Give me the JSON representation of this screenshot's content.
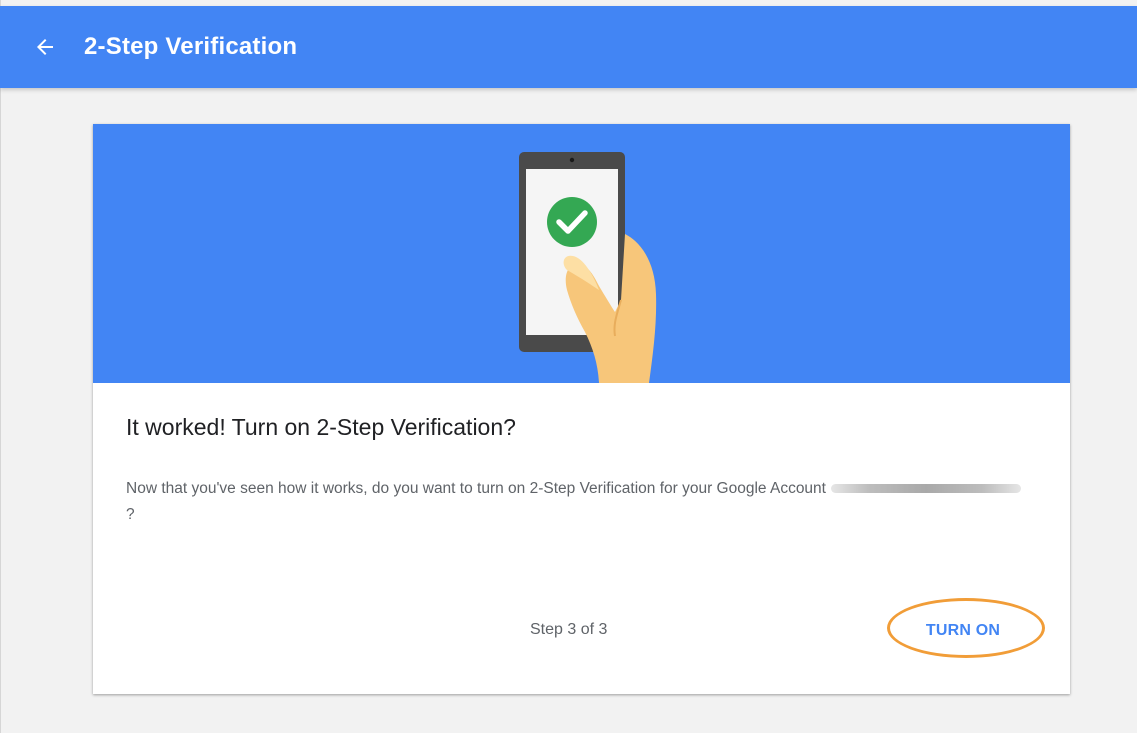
{
  "header": {
    "title": "2-Step Verification",
    "back_icon": "arrow-left-icon",
    "background_color": "#4285f4"
  },
  "hero": {
    "illustration": "phone-checkmark-hand",
    "background_color": "#4285f4",
    "check_color": "#34a853"
  },
  "card": {
    "title": "It worked! Turn on 2-Step Verification?",
    "body_prefix": "Now that you've seen how it works, do you want to turn on 2-Step Verification for your Google Account ",
    "body_suffix": "?",
    "step_text": "Step 3 of 3",
    "turn_on_label": "TURN ON",
    "accent_color": "#4285f4"
  },
  "annotation": {
    "highlight_color": "#f19d38"
  }
}
